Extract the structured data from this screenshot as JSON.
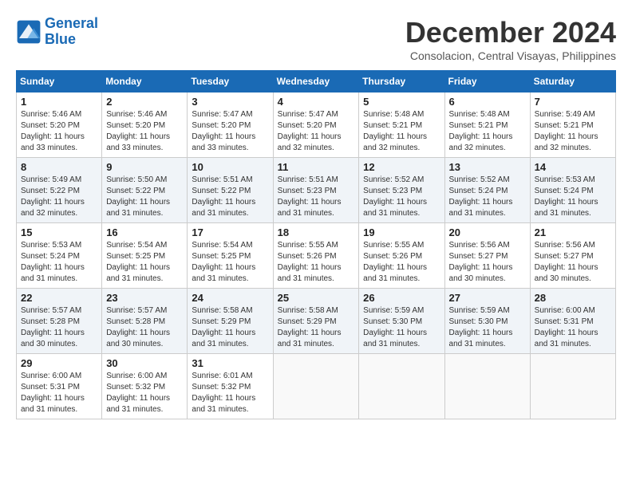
{
  "logo": {
    "line1": "General",
    "line2": "Blue"
  },
  "title": "December 2024",
  "location": "Consolacion, Central Visayas, Philippines",
  "days_of_week": [
    "Sunday",
    "Monday",
    "Tuesday",
    "Wednesday",
    "Thursday",
    "Friday",
    "Saturday"
  ],
  "weeks": [
    [
      {
        "day": "1",
        "sunrise": "5:46 AM",
        "sunset": "5:20 PM",
        "daylight": "11 hours and 33 minutes."
      },
      {
        "day": "2",
        "sunrise": "5:46 AM",
        "sunset": "5:20 PM",
        "daylight": "11 hours and 33 minutes."
      },
      {
        "day": "3",
        "sunrise": "5:47 AM",
        "sunset": "5:20 PM",
        "daylight": "11 hours and 33 minutes."
      },
      {
        "day": "4",
        "sunrise": "5:47 AM",
        "sunset": "5:20 PM",
        "daylight": "11 hours and 32 minutes."
      },
      {
        "day": "5",
        "sunrise": "5:48 AM",
        "sunset": "5:21 PM",
        "daylight": "11 hours and 32 minutes."
      },
      {
        "day": "6",
        "sunrise": "5:48 AM",
        "sunset": "5:21 PM",
        "daylight": "11 hours and 32 minutes."
      },
      {
        "day": "7",
        "sunrise": "5:49 AM",
        "sunset": "5:21 PM",
        "daylight": "11 hours and 32 minutes."
      }
    ],
    [
      {
        "day": "8",
        "sunrise": "5:49 AM",
        "sunset": "5:22 PM",
        "daylight": "11 hours and 32 minutes."
      },
      {
        "day": "9",
        "sunrise": "5:50 AM",
        "sunset": "5:22 PM",
        "daylight": "11 hours and 31 minutes."
      },
      {
        "day": "10",
        "sunrise": "5:51 AM",
        "sunset": "5:22 PM",
        "daylight": "11 hours and 31 minutes."
      },
      {
        "day": "11",
        "sunrise": "5:51 AM",
        "sunset": "5:23 PM",
        "daylight": "11 hours and 31 minutes."
      },
      {
        "day": "12",
        "sunrise": "5:52 AM",
        "sunset": "5:23 PM",
        "daylight": "11 hours and 31 minutes."
      },
      {
        "day": "13",
        "sunrise": "5:52 AM",
        "sunset": "5:24 PM",
        "daylight": "11 hours and 31 minutes."
      },
      {
        "day": "14",
        "sunrise": "5:53 AM",
        "sunset": "5:24 PM",
        "daylight": "11 hours and 31 minutes."
      }
    ],
    [
      {
        "day": "15",
        "sunrise": "5:53 AM",
        "sunset": "5:24 PM",
        "daylight": "11 hours and 31 minutes."
      },
      {
        "day": "16",
        "sunrise": "5:54 AM",
        "sunset": "5:25 PM",
        "daylight": "11 hours and 31 minutes."
      },
      {
        "day": "17",
        "sunrise": "5:54 AM",
        "sunset": "5:25 PM",
        "daylight": "11 hours and 31 minutes."
      },
      {
        "day": "18",
        "sunrise": "5:55 AM",
        "sunset": "5:26 PM",
        "daylight": "11 hours and 31 minutes."
      },
      {
        "day": "19",
        "sunrise": "5:55 AM",
        "sunset": "5:26 PM",
        "daylight": "11 hours and 31 minutes."
      },
      {
        "day": "20",
        "sunrise": "5:56 AM",
        "sunset": "5:27 PM",
        "daylight": "11 hours and 30 minutes."
      },
      {
        "day": "21",
        "sunrise": "5:56 AM",
        "sunset": "5:27 PM",
        "daylight": "11 hours and 30 minutes."
      }
    ],
    [
      {
        "day": "22",
        "sunrise": "5:57 AM",
        "sunset": "5:28 PM",
        "daylight": "11 hours and 30 minutes."
      },
      {
        "day": "23",
        "sunrise": "5:57 AM",
        "sunset": "5:28 PM",
        "daylight": "11 hours and 30 minutes."
      },
      {
        "day": "24",
        "sunrise": "5:58 AM",
        "sunset": "5:29 PM",
        "daylight": "11 hours and 31 minutes."
      },
      {
        "day": "25",
        "sunrise": "5:58 AM",
        "sunset": "5:29 PM",
        "daylight": "11 hours and 31 minutes."
      },
      {
        "day": "26",
        "sunrise": "5:59 AM",
        "sunset": "5:30 PM",
        "daylight": "11 hours and 31 minutes."
      },
      {
        "day": "27",
        "sunrise": "5:59 AM",
        "sunset": "5:30 PM",
        "daylight": "11 hours and 31 minutes."
      },
      {
        "day": "28",
        "sunrise": "6:00 AM",
        "sunset": "5:31 PM",
        "daylight": "11 hours and 31 minutes."
      }
    ],
    [
      {
        "day": "29",
        "sunrise": "6:00 AM",
        "sunset": "5:31 PM",
        "daylight": "11 hours and 31 minutes."
      },
      {
        "day": "30",
        "sunrise": "6:00 AM",
        "sunset": "5:32 PM",
        "daylight": "11 hours and 31 minutes."
      },
      {
        "day": "31",
        "sunrise": "6:01 AM",
        "sunset": "5:32 PM",
        "daylight": "11 hours and 31 minutes."
      },
      null,
      null,
      null,
      null
    ]
  ],
  "labels": {
    "sunrise": "Sunrise:",
    "sunset": "Sunset:",
    "daylight": "Daylight:"
  }
}
